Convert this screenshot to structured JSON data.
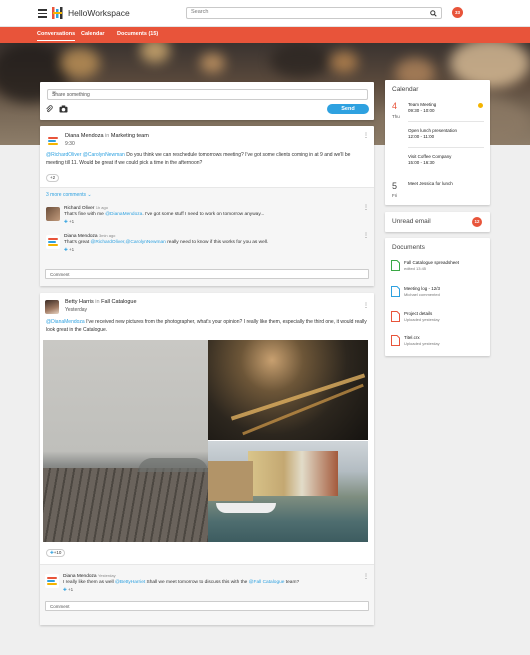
{
  "app": {
    "title": "HelloWorkspace"
  },
  "header": {
    "search_placeholder": "Search",
    "user_badge": "33"
  },
  "nav": {
    "tabs": [
      "Conversations",
      "Calendar",
      "Documents (15)"
    ],
    "active": "Conversations"
  },
  "composer": {
    "placeholder": "Share something",
    "send_label": "Send"
  },
  "post1": {
    "author": "Diana Mendoza",
    "in_word": "in",
    "group": "Marketing team",
    "time": "9:30",
    "mention1": "@RichardOliver",
    "mention2": "@CarolynNewman",
    "body": "Do you think we can reschedule tomorrows meeting? I've got some clients coming in at 9 and we'll be meeting till 11.  Would be great if we could pick a time in the afternoon?",
    "reactions": "+2",
    "more_comments": "3 more comments",
    "comments": [
      {
        "author": "Richard Oliver",
        "time": "1h ago",
        "pre": "That's fine with me",
        "mention": "@DianaMendoza",
        "post": ". I've got some stuff I need to work on tomorrow anyway...",
        "likes": "+1"
      },
      {
        "author": "Diana Mendoza",
        "time": "3min ago",
        "pre": "That's great",
        "mention": "@RichardOliver,@CarolynNewman",
        "post": " really need to know if this works for you as well.",
        "likes": "+1"
      }
    ],
    "comment_placeholder": "Comment"
  },
  "post2": {
    "author": "Betty Harris",
    "in_word": "in",
    "group": "Fall Catalogue",
    "time": "Yesterday",
    "mention": "@DianaMendoza",
    "body": " I've received new pictures from the photographer, what's your opinion? I really like them, especially the third one, it would really look great in the Catalogue.",
    "reactions": "+10",
    "comments": [
      {
        "author": "Diana Mendoza",
        "time": "Yesterday",
        "pre": "I really like them as well",
        "mention": "@BettyHarriet",
        "mid": " Shall we meet tomorrow to discuss this with the ",
        "mention2": "@Fall Catalogue",
        "post": " team?",
        "likes": "+1"
      }
    ],
    "comment_placeholder": "Comment"
  },
  "calendar": {
    "title": "Calendar",
    "days": [
      {
        "num": "4",
        "name": "Thu",
        "color": "#e8543a"
      },
      {
        "num": "5",
        "name": "Fri",
        "color": "#444444"
      }
    ],
    "events": [
      {
        "title": "Team Meeting",
        "time": "09:30 - 10:00"
      },
      {
        "title": "Open lunch presentation",
        "time": "12:00 - 11:00"
      },
      {
        "title": "Visit Coffee Company",
        "time": "15:00 - 16:30"
      },
      {
        "title": "Meet Jessica for lunch",
        "time": ""
      }
    ]
  },
  "unread": {
    "label": "Unread email",
    "count": "12"
  },
  "documents": {
    "title": "Documents",
    "items": [
      {
        "name": "Fall Catalogue spreadsheet",
        "meta": "edited 13:45",
        "icon": "spreadsheet-icon",
        "color": "#3aa845"
      },
      {
        "name": "Meeting log - 12/3",
        "meta": "Michael commented",
        "icon": "document-icon",
        "color": "#2ea1e0"
      },
      {
        "name": "Project details",
        "meta": "Uploaded yesterday",
        "icon": "presentation-icon",
        "color": "#e8543a"
      },
      {
        "name": "Titel.crx",
        "meta": "Uploaded yesterday",
        "icon": "file-icon",
        "color": "#e8543a"
      }
    ]
  },
  "colors": {
    "accent": "#e8543a",
    "link": "#2ea1e0"
  }
}
